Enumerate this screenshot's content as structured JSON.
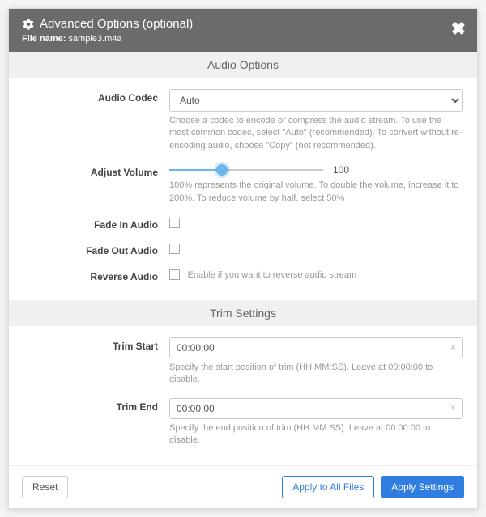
{
  "header": {
    "title": "Advanced Options (optional)",
    "file_label": "File name:",
    "file_name": "sample3.m4a"
  },
  "sections": {
    "audio_title": "Audio Options",
    "trim_title": "Trim Settings"
  },
  "audio": {
    "codec": {
      "label": "Audio Codec",
      "value": "Auto",
      "help": "Choose a codec to encode or compress the audio stream. To use the most common codec, select \"Auto\" (recommended). To convert without re-encoding audio, choose \"Copy\" (not recommended)."
    },
    "volume": {
      "label": "Adjust Volume",
      "value": "100",
      "help": "100% represents the original volume. To double the volume, increase it to 200%. To reduce volume by half, select 50%"
    },
    "fade_in": {
      "label": "Fade In Audio"
    },
    "fade_out": {
      "label": "Fade Out Audio"
    },
    "reverse": {
      "label": "Reverse Audio",
      "help": "Enable if you want to reverse audio stream"
    }
  },
  "trim": {
    "start": {
      "label": "Trim Start",
      "value": "00:00:00",
      "help": "Specify the start position of trim (HH:MM:SS). Leave at 00:00:00 to disable."
    },
    "end": {
      "label": "Trim End",
      "value": "00:00:00",
      "help": "Specify the end position of trim (HH:MM:SS). Leave at 00:00:00 to disable."
    }
  },
  "footer": {
    "reset": "Reset",
    "apply_all": "Apply to All Files",
    "apply": "Apply Settings"
  }
}
